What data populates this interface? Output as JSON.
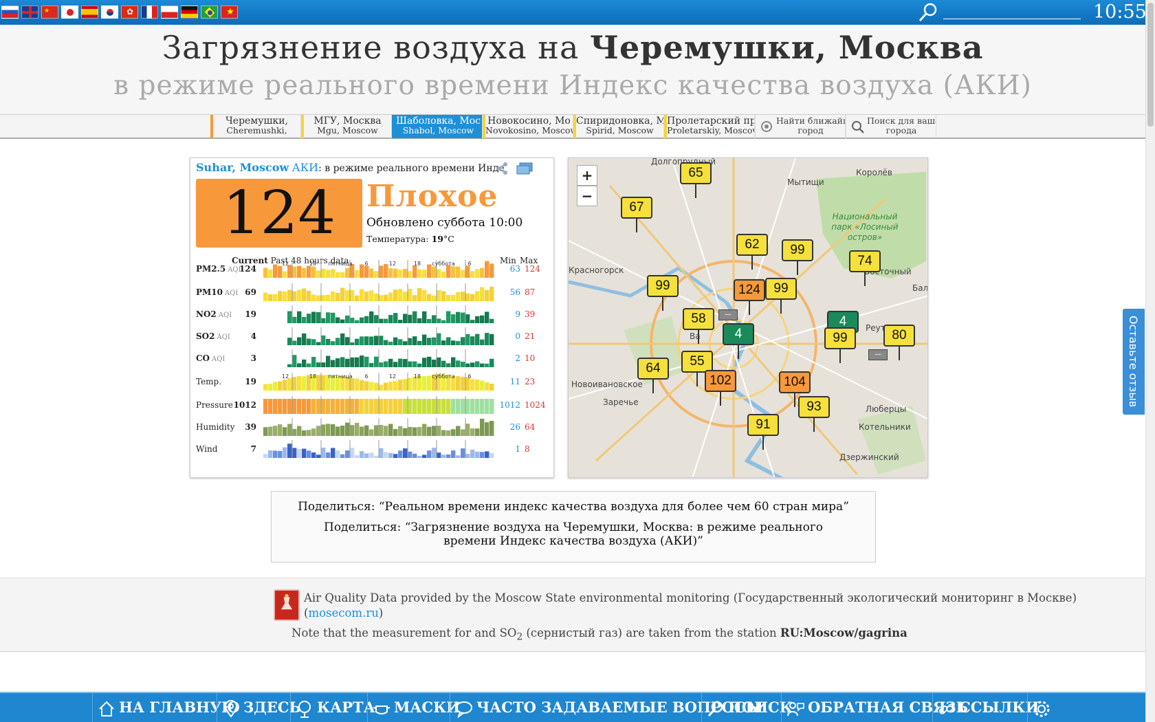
{
  "topbar": {
    "flags": [
      "Russian",
      "UK",
      "China",
      "Japan",
      "Spain",
      "Korea",
      "Hong Kong",
      "France",
      "Poland",
      "Germany",
      "Brazil",
      "Vietnam"
    ],
    "clock": "10:55",
    "icons": [
      "search-icon"
    ]
  },
  "header": {
    "title_prefix": "Загрязнение воздуха на ",
    "title_bold": "Черемушки, Москва",
    "subtitle": "в режиме реального времени Индекс качества воздуха (АКИ)"
  },
  "tabs": [
    {
      "l1": "Черемушки,",
      "l2": "Cheremushki,",
      "accent": "#f7993b"
    },
    {
      "l1": "МГУ, Москва",
      "l2": "Mgu, Moscow",
      "accent": "#f6d43b"
    },
    {
      "l1": "Шаболовка, Мос",
      "l2": "Shabol, Moscow",
      "accent": "#1f8fd6",
      "active": true
    },
    {
      "l1": "Новокосино, Мо",
      "l2": "Novokosino, Moscow",
      "accent": "#f6d43b"
    },
    {
      "l1": "Спиридоновка, М",
      "l2": "Spirid, Moscow",
      "accent": "#f6d43b"
    },
    {
      "l1": "Пролетарский пр",
      "l2": "Proletarskiy, Moscow",
      "accent": "#f6d43b"
    }
  ],
  "tools": [
    {
      "l1": "Найти ближайший",
      "l2": "город",
      "icon": "locate-icon"
    },
    {
      "l1": "Поиск для вашего",
      "l2": "города",
      "icon": "search-icon"
    }
  ],
  "card": {
    "station": "Suhar, Moscow",
    "aqi_label": "АКИ",
    "desc": ": в режиме реального времени Инде",
    "aqi_value": "124",
    "status": "Плохое",
    "updated": "Обновлено суббота 10:00",
    "temp_label": "Температура: ",
    "temp_value": "19",
    "temp_unit": "°C",
    "hist_current": "Current",
    "hist_past": "Past 48 hours data",
    "min_label": "Min",
    "max_label": "Max",
    "tick_labels": [
      "12",
      "18",
      "пятница",
      "6",
      "12",
      "18",
      "суббота",
      "6"
    ],
    "rows": [
      {
        "name": "PM2.5",
        "unit": "AQI",
        "cur": "124",
        "min": "63",
        "max": "124",
        "kind": "aqi",
        "seed": 1,
        "ticks": true
      },
      {
        "name": "PM10",
        "unit": "AQI",
        "cur": "69",
        "min": "56",
        "max": "87",
        "kind": "pm10",
        "seed": 2
      },
      {
        "name": "NO2",
        "unit": "AQI",
        "cur": "19",
        "min": "9",
        "max": "39",
        "kind": "green",
        "seed": 3
      },
      {
        "name": "SO2",
        "unit": "AQI",
        "cur": "4",
        "min": "0",
        "max": "21",
        "kind": "green",
        "seed": 4
      },
      {
        "name": "CO",
        "unit": "AQI",
        "cur": "3",
        "min": "2",
        "max": "10",
        "kind": "green",
        "seed": 5
      },
      {
        "name": "Temp.",
        "unit": "",
        "cur": "19",
        "min": "11",
        "max": "23",
        "kind": "temp",
        "seed": 6,
        "ticks": true
      },
      {
        "name": "Pressure",
        "unit": "",
        "cur": "1012",
        "min": "1012",
        "max": "1024",
        "kind": "press",
        "seed": 7
      },
      {
        "name": "Humidity",
        "unit": "",
        "cur": "39",
        "min": "26",
        "max": "64",
        "kind": "hum",
        "seed": 8
      },
      {
        "name": "Wind",
        "unit": "",
        "cur": "7",
        "min": "1",
        "max": "8",
        "kind": "wind",
        "seed": 9
      }
    ]
  },
  "map": {
    "zoom_in": "+",
    "zoom_out": "−",
    "labels": [
      "Долгопрудный",
      "Мытищи",
      "Королёв",
      "Национальный парк «Лосиный остров»",
      "Красногорск",
      "Бал",
      "Реутов",
      "Новоивановское",
      "Заречье",
      "Люберцы",
      "Котельники",
      "Дзержинский",
      "Ва",
      "Восточный"
    ],
    "markers": [
      {
        "v": "65",
        "color": "#f6e03b"
      },
      {
        "v": "67",
        "color": "#f6e03b"
      },
      {
        "v": "62",
        "color": "#f6e03b"
      },
      {
        "v": "99",
        "color": "#f6e03b"
      },
      {
        "v": "74",
        "color": "#f6e03b"
      },
      {
        "v": "99",
        "color": "#f6e03b"
      },
      {
        "v": "124",
        "color": "#f7993b"
      },
      {
        "v": "99",
        "color": "#f6e03b"
      },
      {
        "v": "58",
        "color": "#f6e03b"
      },
      {
        "v": "4",
        "color": "#1b8a5a"
      },
      {
        "v": "4",
        "color": "#1b8a5a"
      },
      {
        "v": "99",
        "color": "#f6e03b"
      },
      {
        "v": "80",
        "color": "#f6e03b"
      },
      {
        "v": "64",
        "color": "#f6e03b"
      },
      {
        "v": "55",
        "color": "#f6e03b"
      },
      {
        "v": "102",
        "color": "#f7993b"
      },
      {
        "v": "104",
        "color": "#f7993b"
      },
      {
        "v": "93",
        "color": "#f6e03b"
      },
      {
        "v": "91",
        "color": "#f6e03b"
      }
    ],
    "grey_markers": [
      "—",
      "—"
    ]
  },
  "share": {
    "line1": "Поделиться: “Реальном времени индекс качества воздуха для более чем 60 стран мира”",
    "line2": "Поделиться: “Загрязнение воздуха на Черемушки, Москва: в режиме реального времени Индекс качества воздуха (АКИ)”"
  },
  "source": {
    "text1": "Air Quality Data provided by the Moscow State environmental monitoring (Государственный экологический мониторинг в Москве) (",
    "link": "mosecom.ru",
    "text1_end": ")",
    "text2_a": "Note that the measurement for and SO",
    "text2_sub": "2",
    "text2_b": " (сернистый газ) are taken from the station ",
    "station": "RU:Moscow/gagrina"
  },
  "feedback_tab": "Оставьте отзыв",
  "footer": [
    {
      "label": "НА ГЛАВНУЮ",
      "icon": "home-icon"
    },
    {
      "label": "ЗДЕСЬ",
      "icon": "location-pin-icon"
    },
    {
      "label": "КАРТА",
      "icon": "map-icon"
    },
    {
      "label": "МАСКИ",
      "icon": "mask-icon"
    },
    {
      "label": "ЧАСТО ЗАДАВАЕМЫЕ ВОПРОСЫ",
      "icon": "faq-icon"
    },
    {
      "label": "ПОИСК",
      "icon": "search-icon"
    },
    {
      "label": "ОБРАТНАЯ СВЯЗЬ",
      "icon": "feedback-icon"
    },
    {
      "label": "ССЫЛКИ",
      "icon": "link-icon"
    },
    {
      "label": "",
      "icon": "gear-icon"
    }
  ],
  "colors": {
    "brand": "#1f86d0",
    "unhealthy_sensitive": "#f7993b",
    "moderate": "#f6e03b",
    "good": "#1b8a5a",
    "link": "#1f8fd6"
  }
}
